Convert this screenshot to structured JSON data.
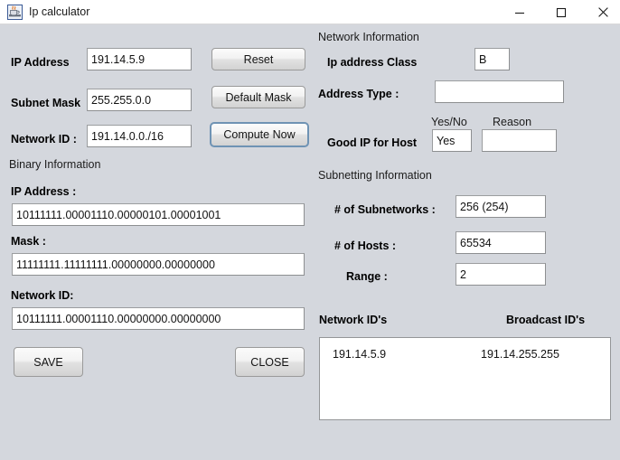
{
  "window": {
    "title": "Ip calculator",
    "icon": "java-coffee-cup-icon",
    "controls": {
      "minimize": "minimize-icon",
      "maximize": "maximize-icon",
      "close": "close-icon"
    },
    "background_color": "#d4d7dd"
  },
  "left_panel": {
    "fields": [
      {
        "label": "IP Address",
        "value": "191.14.5.9"
      },
      {
        "label": "Subnet Mask",
        "value": "255.255.0.0"
      },
      {
        "label": "Network ID :",
        "value": "191.14.0.0./16"
      }
    ],
    "buttons": [
      {
        "label": "Reset",
        "focused": false
      },
      {
        "label": "Default Mask",
        "focused": false
      },
      {
        "label": "Compute Now",
        "focused": true
      }
    ],
    "binary_section": {
      "title": "Binary Information",
      "fields": [
        {
          "label": "IP Address :",
          "value": "10111111.00001110.00000101.00001001"
        },
        {
          "label": "Mask :",
          "value": "11111111.11111111.00000000.00000000"
        },
        {
          "label": "Network ID:",
          "value": "10111111.00001110.00000000.00000000"
        }
      ]
    },
    "bottom_buttons": [
      {
        "label": "SAVE"
      },
      {
        "label": "CLOSE"
      }
    ]
  },
  "right_panel": {
    "network_section": {
      "title": "Network Information",
      "class_label": "Ip address Class",
      "class_value": "B",
      "address_type_label": "Address Type :",
      "address_type_value": "",
      "yes_no_header": "Yes/No",
      "reason_header": "Reason",
      "good_ip_label": "Good IP for Host",
      "good_ip_value": "Yes",
      "reason_value": ""
    },
    "subnetting_section": {
      "title": "Subnetting Information",
      "rows": [
        {
          "label": "# of Subnetworks :",
          "value": "256 (254)"
        },
        {
          "label": "# of Hosts :",
          "value": "65534"
        },
        {
          "label": "Range :",
          "value": "2"
        }
      ]
    },
    "ids_section": {
      "network_ids_header": "Network ID's",
      "broadcast_ids_header": "Broadcast ID's",
      "rows": [
        {
          "network_id": "191.14.5.9",
          "broadcast_id": "191.14.255.255"
        }
      ]
    }
  }
}
